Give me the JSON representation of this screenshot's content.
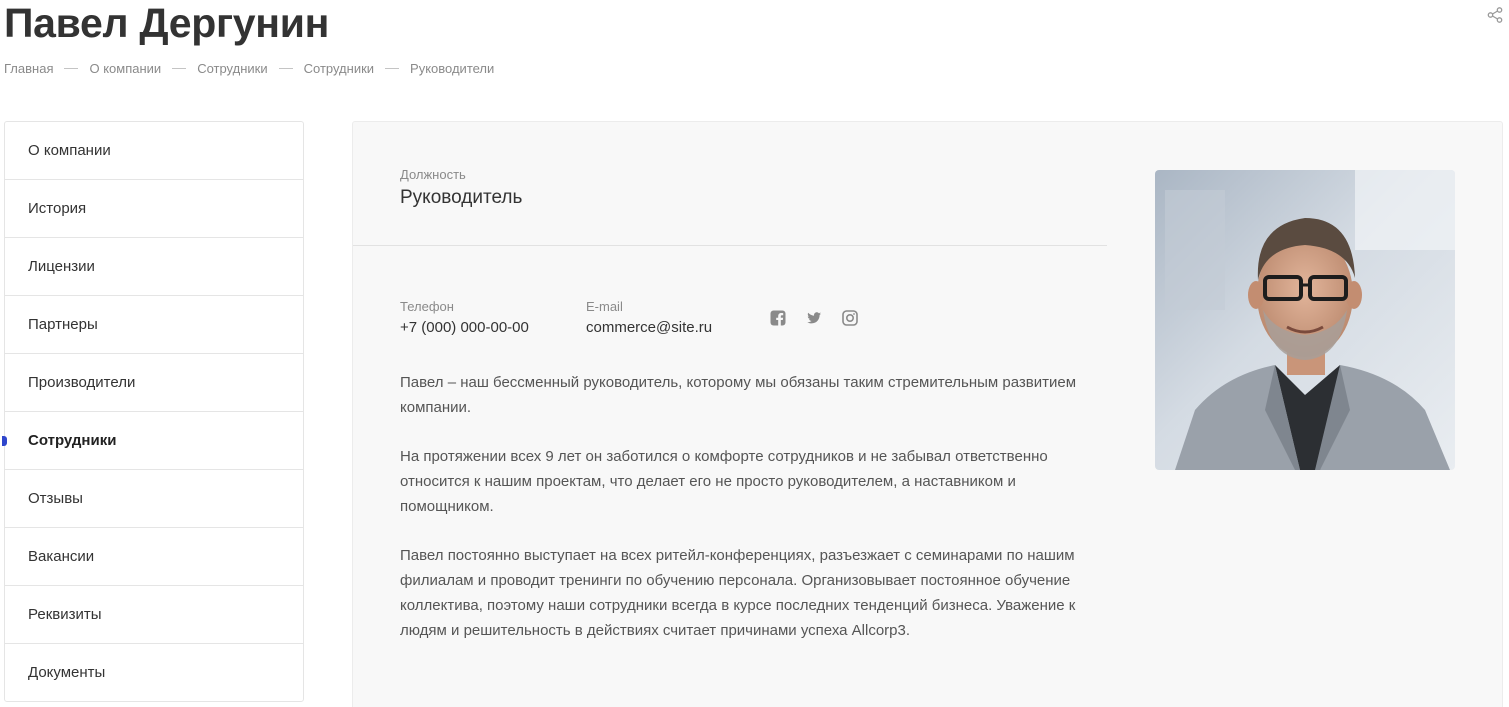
{
  "page": {
    "title": "Павел Дергунин",
    "share_icon": "share-icon"
  },
  "breadcrumb": [
    "Главная",
    "О компании",
    "Сотрудники",
    "Сотрудники",
    "Руководители"
  ],
  "sidebar": {
    "items": [
      {
        "label": "О компании"
      },
      {
        "label": "История"
      },
      {
        "label": "Лицензии"
      },
      {
        "label": "Партнеры"
      },
      {
        "label": "Производители"
      },
      {
        "label": "Сотрудники",
        "active": true
      },
      {
        "label": "Отзывы"
      },
      {
        "label": "Вакансии"
      },
      {
        "label": "Реквизиты"
      },
      {
        "label": "Документы"
      }
    ],
    "accent_color": "#2f46cc"
  },
  "profile": {
    "position_label": "Должность",
    "position_value": "Руководитель",
    "phone_label": "Телефон",
    "phone_value": "+7 (000) 000-00-00",
    "email_label": "E-mail",
    "email_value": "commerce@site.ru",
    "social": [
      "facebook-icon",
      "twitter-icon",
      "instagram-icon"
    ],
    "bio": [
      "Павел – наш бессменный руководитель, которому мы обязаны таким стремительным развитием компании.",
      "На протяжении всех 9 лет он заботился о комфорте сотрудников и не забывал ответственно относится к нашим проектам, что делает его не просто руководителем, а наставником и помощником.",
      "Павел постоянно выступает на всех ритейл-конференциях, разъезжает с семинарами по нашим филиалам и проводит тренинги по обучению персонала. Организовывает постоянное обучение коллектива, поэтому наши сотрудники всегда в курсе последних тенденций бизнеса. Уважение к людям и решительность в действиях считает причинами успеха Allcorp3."
    ]
  }
}
